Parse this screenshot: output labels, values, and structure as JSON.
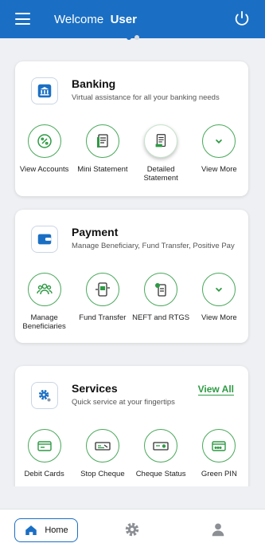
{
  "header": {
    "welcome": "Welcome",
    "user": "User"
  },
  "banking": {
    "title": "Banking",
    "subtitle": "Virtual assistance for all your banking needs",
    "items": [
      {
        "label": "View Accounts"
      },
      {
        "label": "Mini Statement"
      },
      {
        "label": "Detailed Statement"
      },
      {
        "label": "View More"
      }
    ]
  },
  "payment": {
    "title": "Payment",
    "subtitle": "Manage Beneficiary, Fund Transfer, Positive Pay",
    "items": [
      {
        "label": "Manage Beneficiaries"
      },
      {
        "label": "Fund Transfer"
      },
      {
        "label": "NEFT and RTGS"
      },
      {
        "label": "View More"
      }
    ]
  },
  "services": {
    "title": "Services",
    "subtitle": "Quick service at your fingertips",
    "view_all": "View All",
    "items": [
      {
        "label": "Debit Cards"
      },
      {
        "label": "Stop Cheque"
      },
      {
        "label": "Cheque Status"
      },
      {
        "label": "Green PIN"
      }
    ]
  },
  "nav": {
    "home": "Home"
  },
  "colors": {
    "primary": "#1a6fc4",
    "accent_green": "#2e9a44",
    "background": "#eef0f3"
  },
  "icons": [
    "menu-icon",
    "power-icon",
    "bank-icon",
    "wallet-icon",
    "gear-icon",
    "user-icon",
    "home-icon"
  ]
}
